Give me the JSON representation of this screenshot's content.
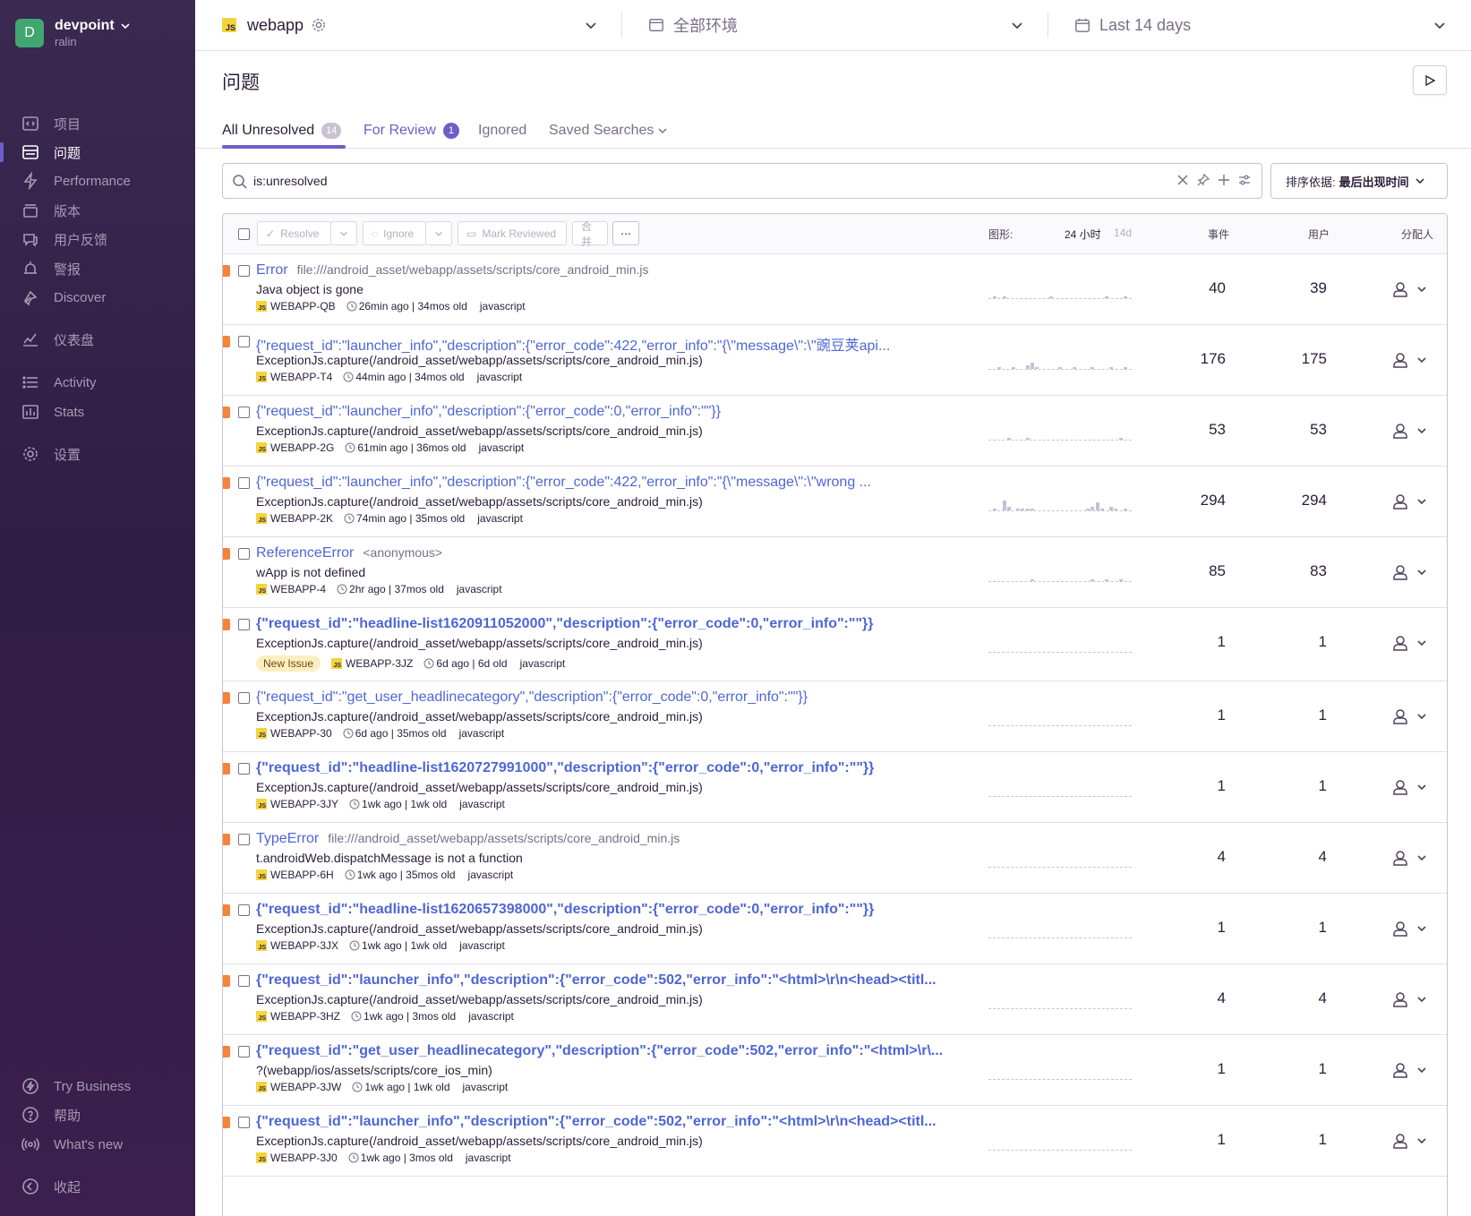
{
  "org": {
    "avatar_letter": "D",
    "name": "devpoint",
    "user": "ralin"
  },
  "nav": [
    {
      "label": "项目",
      "icon": "projects-icon",
      "name": "nav-projects",
      "active": false
    },
    {
      "label": "问题",
      "icon": "issues-icon",
      "name": "nav-issues",
      "active": true
    },
    {
      "label": "Performance",
      "icon": "performance-icon",
      "name": "nav-performance",
      "active": false
    },
    {
      "label": "版本",
      "icon": "releases-icon",
      "name": "nav-releases",
      "active": false
    },
    {
      "label": "用户反馈",
      "icon": "feedback-icon",
      "name": "nav-user-feedback",
      "active": false
    },
    {
      "label": "警报",
      "icon": "alerts-icon",
      "name": "nav-alerts",
      "active": false
    },
    {
      "label": "Discover",
      "icon": "discover-icon",
      "name": "nav-discover",
      "active": false
    },
    {
      "label": "仪表盘",
      "icon": "dashboards-icon",
      "name": "nav-dashboards",
      "active": false
    },
    {
      "label": "Activity",
      "icon": "activity-icon",
      "name": "nav-activity",
      "active": false
    },
    {
      "label": "Stats",
      "icon": "stats-icon",
      "name": "nav-stats",
      "active": false
    },
    {
      "label": "设置",
      "icon": "settings-icon",
      "name": "nav-settings",
      "active": false
    }
  ],
  "nav_bottom": [
    {
      "label": "Try Business",
      "icon": "lightning-icon",
      "name": "nav-try-business"
    },
    {
      "label": "帮助",
      "icon": "help-icon",
      "name": "nav-help"
    },
    {
      "label": "What's new",
      "icon": "broadcast-icon",
      "name": "nav-whats-new"
    },
    {
      "label": "收起",
      "icon": "collapse-icon",
      "name": "nav-collapse"
    }
  ],
  "topbar": {
    "project_badge": "JS",
    "project": "webapp",
    "environment": "全部环境",
    "period": "Last 14 days"
  },
  "page_title": "问题",
  "tabs": [
    {
      "label": "All Unresolved",
      "count": "14"
    },
    {
      "label": "For Review",
      "count": "1"
    },
    {
      "label": "Ignored",
      "count": null
    },
    {
      "label": "Saved Searches",
      "count": null
    }
  ],
  "search": {
    "query": "is:unresolved"
  },
  "sort": {
    "label": "排序依据:",
    "value": "最后出现时间"
  },
  "actions": {
    "resolve": "Resolve",
    "ignore": "Ignore",
    "mark_reviewed": "Mark Reviewed",
    "merge": "合并",
    "more": "⋯"
  },
  "columns": {
    "graph": "图形:",
    "period_24h": "24 小时",
    "period_14d": "14d",
    "events": "事件",
    "users": "用户",
    "assignee": "分配人"
  },
  "colors": {
    "accent": "#6c5fc7",
    "link": "#4e66d6",
    "level_error": "#f4833b",
    "sidebar": "#2f1d45"
  },
  "issues": [
    {
      "title": "Error",
      "location": "file:///android_asset/webapp/assets/scripts/core_android_min.js",
      "message": "Java object is gone",
      "short_id": "WEBAPP-QB",
      "time": "26min ago | 34mos old",
      "platform": "javascript",
      "events": "40",
      "users": "39",
      "new": null,
      "bold": false,
      "spark": [
        0,
        1,
        0,
        1,
        0,
        0,
        0,
        0,
        0,
        0,
        0,
        0,
        0,
        1,
        0,
        0,
        0,
        0,
        0,
        0,
        0,
        0,
        0,
        0,
        0,
        1,
        0,
        0,
        0,
        1,
        0
      ]
    },
    {
      "title": "{\"request_id\":\"launcher_info\",\"description\":{\"error_code\":422,\"error_info\":\"{\\\"message\\\":\\\"豌豆荚api...",
      "location": "",
      "message": "ExceptionJs.capture(/android_asset/webapp/assets/scripts/core_android_min.js)",
      "short_id": "WEBAPP-T4",
      "time": "44min ago | 34mos old",
      "platform": "javascript",
      "events": "176",
      "users": "175",
      "new": null,
      "bold": false,
      "spark": [
        0,
        0,
        1,
        0,
        0,
        1,
        0,
        0,
        2,
        3,
        1,
        0,
        0,
        0,
        0,
        1,
        0,
        0,
        1,
        0,
        0,
        0,
        1,
        0,
        0,
        0,
        1,
        0,
        0,
        1,
        0
      ]
    },
    {
      "title": "{\"request_id\":\"launcher_info\",\"description\":{\"error_code\":0,\"error_info\":\"\"}}",
      "location": "",
      "message": "ExceptionJs.capture(/android_asset/webapp/assets/scripts/core_android_min.js)",
      "short_id": "WEBAPP-2G",
      "time": "61min ago | 36mos old",
      "platform": "javascript",
      "events": "53",
      "users": "53",
      "new": null,
      "bold": false,
      "spark": [
        0,
        0,
        0,
        0,
        1,
        0,
        0,
        0,
        1,
        0,
        0,
        0,
        0,
        0,
        0,
        0,
        0,
        0,
        0,
        0,
        0,
        0,
        0,
        0,
        0,
        0,
        0,
        0,
        1,
        0,
        0
      ]
    },
    {
      "title": "{\"request_id\":\"launcher_info\",\"description\":{\"error_code\":422,\"error_info\":\"{\\\"message\\\":\\\"wrong ...",
      "location": "",
      "message": "ExceptionJs.capture(/android_asset/webapp/assets/scripts/core_android_min.js)",
      "short_id": "WEBAPP-2K",
      "time": "74min ago | 35mos old",
      "platform": "javascript",
      "events": "294",
      "users": "294",
      "new": null,
      "bold": false,
      "spark": [
        0,
        1,
        0,
        5,
        2,
        0,
        1,
        1,
        1,
        1,
        0,
        0,
        0,
        0,
        0,
        0,
        0,
        0,
        0,
        0,
        0,
        1,
        2,
        4,
        1,
        0,
        2,
        1,
        0,
        1,
        0
      ]
    },
    {
      "title": "ReferenceError",
      "location": "<anonymous>",
      "message": "wApp is not defined",
      "short_id": "WEBAPP-4",
      "time": "2hr ago | 37mos old",
      "platform": "javascript",
      "events": "85",
      "users": "83",
      "new": null,
      "bold": false,
      "spark": [
        0,
        0,
        0,
        0,
        0,
        0,
        0,
        0,
        0,
        1,
        0,
        0,
        0,
        0,
        0,
        0,
        0,
        0,
        0,
        0,
        0,
        0,
        1,
        0,
        0,
        1,
        0,
        0,
        1,
        0,
        0
      ]
    },
    {
      "title": "{\"request_id\":\"headline-list1620911052000\",\"description\":{\"error_code\":0,\"error_info\":\"\"}}",
      "location": "",
      "message": "ExceptionJs.capture(/android_asset/webapp/assets/scripts/core_android_min.js)",
      "short_id": "WEBAPP-3JZ",
      "time": "6d ago | 6d old",
      "platform": "javascript",
      "events": "1",
      "users": "1",
      "new": "New Issue",
      "bold": true,
      "spark": [
        0,
        0,
        0,
        0,
        0,
        0,
        0,
        0,
        0,
        0,
        0,
        0,
        0,
        0,
        0,
        0,
        0,
        0,
        0,
        0,
        0,
        0,
        0,
        0,
        0,
        0,
        0,
        0,
        0,
        0,
        0
      ]
    },
    {
      "title": "{\"request_id\":\"get_user_headlinecategory\",\"description\":{\"error_code\":0,\"error_info\":\"\"}}",
      "location": "",
      "message": "ExceptionJs.capture(/android_asset/webapp/assets/scripts/core_android_min.js)",
      "short_id": "WEBAPP-30",
      "time": "6d ago | 35mos old",
      "platform": "javascript",
      "events": "1",
      "users": "1",
      "new": null,
      "bold": false,
      "spark": [
        0,
        0,
        0,
        0,
        0,
        0,
        0,
        0,
        0,
        0,
        0,
        0,
        0,
        0,
        0,
        0,
        0,
        0,
        0,
        0,
        0,
        0,
        0,
        0,
        0,
        0,
        0,
        0,
        0,
        0,
        0
      ]
    },
    {
      "title": "{\"request_id\":\"headline-list1620727991000\",\"description\":{\"error_code\":0,\"error_info\":\"\"}}",
      "location": "",
      "message": "ExceptionJs.capture(/android_asset/webapp/assets/scripts/core_android_min.js)",
      "short_id": "WEBAPP-3JY",
      "time": "1wk ago | 1wk old",
      "platform": "javascript",
      "events": "1",
      "users": "1",
      "new": null,
      "bold": true,
      "spark": [
        0,
        0,
        0,
        0,
        0,
        0,
        0,
        0,
        0,
        0,
        0,
        0,
        0,
        0,
        0,
        0,
        0,
        0,
        0,
        0,
        0,
        0,
        0,
        0,
        0,
        0,
        0,
        0,
        0,
        0,
        0
      ]
    },
    {
      "title": "TypeError",
      "location": "file:///android_asset/webapp/assets/scripts/core_android_min.js",
      "message": "t.androidWeb.dispatchMessage is not a function",
      "short_id": "WEBAPP-6H",
      "time": "1wk ago | 35mos old",
      "platform": "javascript",
      "events": "4",
      "users": "4",
      "new": null,
      "bold": false,
      "spark": [
        0,
        0,
        0,
        0,
        0,
        0,
        0,
        0,
        0,
        0,
        0,
        0,
        0,
        0,
        0,
        0,
        0,
        0,
        0,
        0,
        0,
        0,
        0,
        0,
        0,
        0,
        0,
        0,
        0,
        0,
        0
      ]
    },
    {
      "title": "{\"request_id\":\"headline-list1620657398000\",\"description\":{\"error_code\":0,\"error_info\":\"\"}}",
      "location": "",
      "message": "ExceptionJs.capture(/android_asset/webapp/assets/scripts/core_android_min.js)",
      "short_id": "WEBAPP-3JX",
      "time": "1wk ago | 1wk old",
      "platform": "javascript",
      "events": "1",
      "users": "1",
      "new": null,
      "bold": true,
      "spark": [
        0,
        0,
        0,
        0,
        0,
        0,
        0,
        0,
        0,
        0,
        0,
        0,
        0,
        0,
        0,
        0,
        0,
        0,
        0,
        0,
        0,
        0,
        0,
        0,
        0,
        0,
        0,
        0,
        0,
        0,
        0
      ]
    },
    {
      "title": "{\"request_id\":\"launcher_info\",\"description\":{\"error_code\":502,\"error_info\":\"<html>\\r\\n<head><titl...",
      "location": "",
      "message": "ExceptionJs.capture(/android_asset/webapp/assets/scripts/core_android_min.js)",
      "short_id": "WEBAPP-3HZ",
      "time": "1wk ago | 3mos old",
      "platform": "javascript",
      "events": "4",
      "users": "4",
      "new": null,
      "bold": true,
      "spark": [
        0,
        0,
        0,
        0,
        0,
        0,
        0,
        0,
        0,
        0,
        0,
        0,
        0,
        0,
        0,
        0,
        0,
        0,
        0,
        0,
        0,
        0,
        0,
        0,
        0,
        0,
        0,
        0,
        0,
        0,
        0
      ]
    },
    {
      "title": "{\"request_id\":\"get_user_headlinecategory\",\"description\":{\"error_code\":502,\"error_info\":\"<html>\\r\\...",
      "location": "",
      "message": "?(webapp/ios/assets/scripts/core_ios_min)",
      "short_id": "WEBAPP-3JW",
      "time": "1wk ago | 1wk old",
      "platform": "javascript",
      "events": "1",
      "users": "1",
      "new": null,
      "bold": true,
      "spark": [
        0,
        0,
        0,
        0,
        0,
        0,
        0,
        0,
        0,
        0,
        0,
        0,
        0,
        0,
        0,
        0,
        0,
        0,
        0,
        0,
        0,
        0,
        0,
        0,
        0,
        0,
        0,
        0,
        0,
        0,
        0
      ]
    },
    {
      "title": "{\"request_id\":\"launcher_info\",\"description\":{\"error_code\":502,\"error_info\":\"<html>\\r\\n<head><titl...",
      "location": "",
      "message": "ExceptionJs.capture(/android_asset/webapp/assets/scripts/core_android_min.js)",
      "short_id": "WEBAPP-3J0",
      "time": "1wk ago | 3mos old",
      "platform": "javascript",
      "events": "1",
      "users": "1",
      "new": null,
      "bold": true,
      "spark": [
        0,
        0,
        0,
        0,
        0,
        0,
        0,
        0,
        0,
        0,
        0,
        0,
        0,
        0,
        0,
        0,
        0,
        0,
        0,
        0,
        0,
        0,
        0,
        0,
        0,
        0,
        0,
        0,
        0,
        0,
        0
      ]
    }
  ]
}
